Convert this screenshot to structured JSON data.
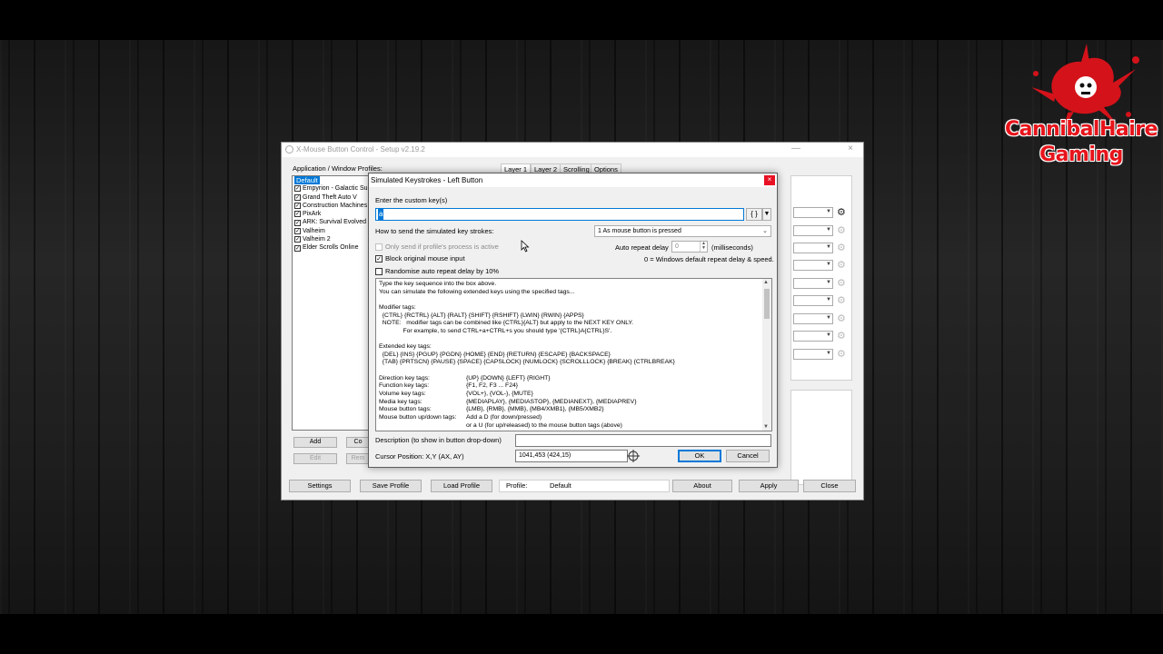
{
  "logo": {
    "line1": "CannibalHaire",
    "line2": "Gaming",
    "color": "#e8141b"
  },
  "main_window": {
    "title": "X-Mouse Button Control - Setup v2.19.2",
    "profiles_label": "Application / Window Profiles:",
    "tabs": [
      "Layer 1",
      "Layer 2",
      "Scrolling",
      "Options"
    ],
    "profiles": [
      {
        "name": "Default",
        "checked": true,
        "selected": true
      },
      {
        "name": "Empyrion - Galactic Sur",
        "checked": true,
        "selected": false
      },
      {
        "name": "Grand Theft Auto V",
        "checked": true,
        "selected": false
      },
      {
        "name": "Construction Machines",
        "checked": true,
        "selected": false
      },
      {
        "name": "PixArk",
        "checked": true,
        "selected": false
      },
      {
        "name": "ARK: Survival Evolved",
        "checked": true,
        "selected": false
      },
      {
        "name": "Valheim",
        "checked": true,
        "selected": false
      },
      {
        "name": "Valheim 2",
        "checked": true,
        "selected": false
      },
      {
        "name": "Elder Scrolls Online",
        "checked": true,
        "selected": false
      }
    ],
    "list_buttons": {
      "add": "Add",
      "copy": "Co",
      "edit": "Edit",
      "remove": "Rem"
    },
    "bottom_buttons": {
      "settings": "Settings",
      "save_profile": "Save Profile",
      "load_profile": "Load Profile",
      "about": "About",
      "apply": "Apply",
      "close": "Close"
    },
    "profile_status": {
      "label": "Profile:",
      "value": "Default"
    }
  },
  "dialog": {
    "title": "Simulated Keystrokes - Left Button",
    "close_glyph": "×",
    "enter_keys_label": "Enter the custom key(s)",
    "key_value": "a",
    "tag_button": "{ }",
    "how_to_send_label": "How to send the simulated key strokes:",
    "send_mode": "1 As mouse button is pressed",
    "only_send_label": "Only send if profile's process is active",
    "block_input_label": "Block original mouse input",
    "randomise_label": "Randomise auto repeat delay by 10%",
    "auto_repeat_label": "Auto repeat delay",
    "auto_repeat_value": "0",
    "milliseconds_label": "(milliseconds)",
    "repeat_note": "0 = Windows default repeat delay & speed.",
    "help_lines": [
      [
        "Type the key sequence into the box above.",
        ""
      ],
      [
        "You can simulate the following extended keys using the specified tags...",
        ""
      ],
      [
        "",
        ""
      ],
      [
        "Modifier tags:",
        ""
      ],
      [
        "  {CTRL} {RCTRL} {ALT} {RALT} {SHIFT} {RSHIFT} {LWIN} {RWIN} {APPS}",
        ""
      ],
      [
        "  NOTE:   modifier tags can be combined like {CTRL}{ALT} but apply to the NEXT KEY ONLY.",
        ""
      ],
      [
        "              For example, to send CTRL+a+CTRL+s you should type '{CTRL}A{CTRL}S'.",
        ""
      ],
      [
        "",
        ""
      ],
      [
        "Extended key tags:",
        ""
      ],
      [
        "  {DEL} {INS} {PGUP} {PGDN} {HOME} {END} {RETURN} {ESCAPE} {BACKSPACE}",
        ""
      ],
      [
        "  {TAB} {PRTSCN} {PAUSE} {SPACE} {CAPSLOCK} {NUMLOCK} {SCROLLLOCK} {BREAK} {CTRLBREAK}",
        ""
      ],
      [
        "",
        ""
      ],
      [
        "Direction key tags:",
        "{UP} {DOWN} {LEFT} {RIGHT}"
      ],
      [
        "Function key tags:",
        "{F1, F2, F3 ... F24}"
      ],
      [
        "Volume key tags:",
        "{VOL+}, {VOL-}, {MUTE}"
      ],
      [
        "Media key tags:",
        "{MEDIAPLAY}, {MEDIASTOP}, {MEDIANEXT}, {MEDIAPREV}"
      ],
      [
        "Mouse button tags:",
        "{LMB}, {RMB}, {MMB}, {MB4/XMB1}, {MB5/XMB2}"
      ],
      [
        "Mouse button up/down tags:",
        "Add a D (for down/pressed)"
      ],
      [
        "",
        "or a U (for up/released) to the mouse button tags (above)"
      ]
    ],
    "description_label": "Description (to show in button drop-down)",
    "description_value": "",
    "cursor_label": "Cursor Position: X,Y (AX, AY)",
    "cursor_value": "1041,453 (424,15)",
    "ok_label": "OK",
    "cancel_label": "Cancel"
  }
}
